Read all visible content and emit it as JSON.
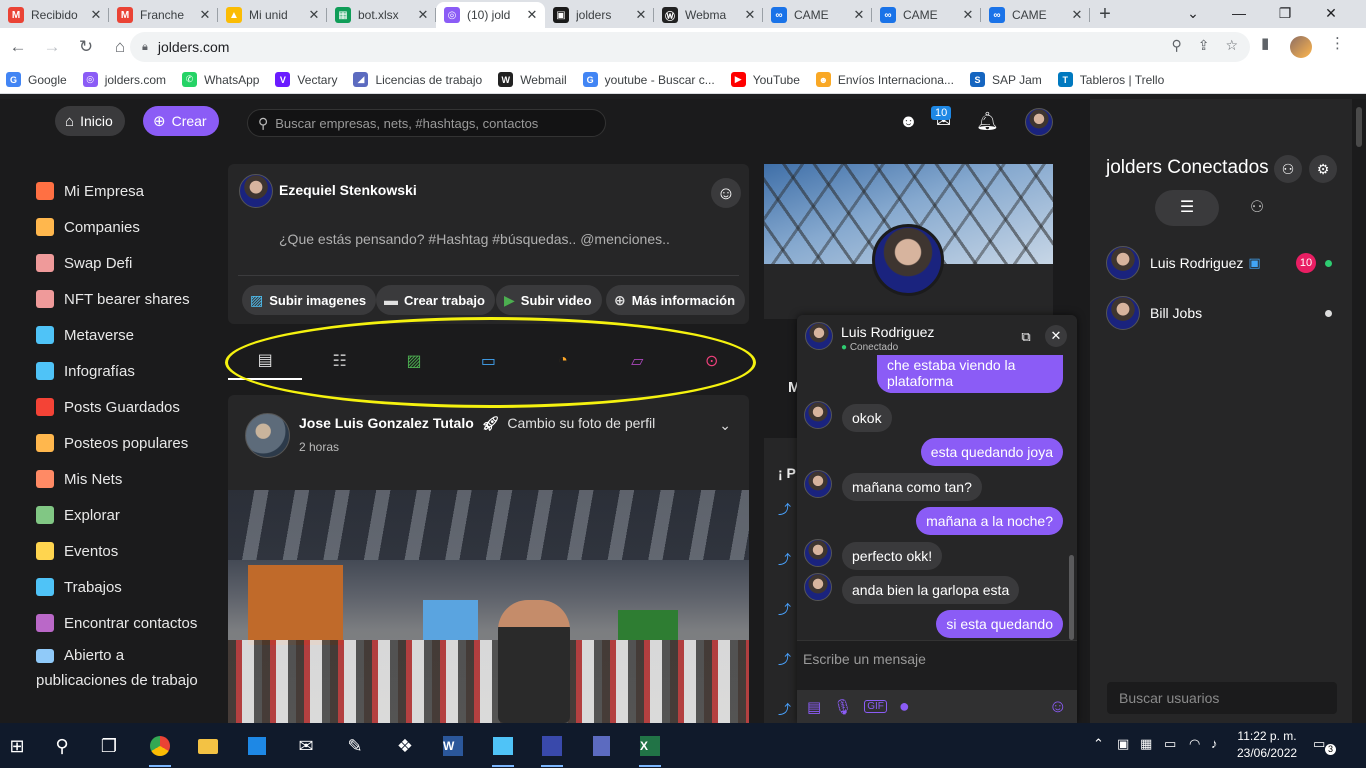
{
  "browser": {
    "tabs": [
      {
        "title": "Recibido",
        "icon": "gmail-icon",
        "color": "#ea4335",
        "glyph": "M"
      },
      {
        "title": "Franche",
        "icon": "gmail-icon",
        "color": "#ea4335",
        "glyph": "M"
      },
      {
        "title": "Mi unid",
        "icon": "drive-icon",
        "color": "#fbbc04",
        "glyph": "▲"
      },
      {
        "title": "bot.xlsx",
        "icon": "sheets-icon",
        "color": "#0f9d58",
        "glyph": "▦"
      },
      {
        "title": "(10) jold",
        "icon": "jolders-icon",
        "color": "#8b5cf6",
        "glyph": "◎"
      },
      {
        "title": "jolders",
        "icon": "jolders-icon",
        "color": "#1a1a1a",
        "glyph": "▣"
      },
      {
        "title": "Webma",
        "icon": "webmail-icon",
        "color": "#222",
        "glyph": "Ⓦ"
      },
      {
        "title": "CAME",
        "icon": "link-icon",
        "color": "#1a73e8",
        "glyph": "∞"
      },
      {
        "title": "CAME",
        "icon": "link-icon",
        "color": "#1a73e8",
        "glyph": "∞"
      },
      {
        "title": "CAME",
        "icon": "link-icon",
        "color": "#1a73e8",
        "glyph": "∞"
      }
    ],
    "active_tab": 4,
    "url": "jolders.com",
    "bookmarks": [
      {
        "label": "Google",
        "icon": "google-icon",
        "color": "#4285f4",
        "glyph": "G"
      },
      {
        "label": "jolders.com",
        "icon": "jolders-icon",
        "color": "#8b5cf6",
        "glyph": "◎"
      },
      {
        "label": "WhatsApp",
        "icon": "whatsapp-icon",
        "color": "#25d366",
        "glyph": "✆"
      },
      {
        "label": "Vectary",
        "icon": "vectary-icon",
        "color": "#6a1bff",
        "glyph": "V"
      },
      {
        "label": "Licencias de trabajo",
        "icon": "licencias-icon",
        "color": "#5c6bc0",
        "glyph": "◢"
      },
      {
        "label": "Webmail",
        "icon": "webmail-icon",
        "color": "#222",
        "glyph": "W"
      },
      {
        "label": "youtube - Buscar c...",
        "icon": "google-icon",
        "color": "#4285f4",
        "glyph": "G"
      },
      {
        "label": "YouTube",
        "icon": "youtube-icon",
        "color": "#ff0000",
        "glyph": "▶"
      },
      {
        "label": "Envíos Internaciona...",
        "icon": "envios-icon",
        "color": "#f9a825",
        "glyph": "☻"
      },
      {
        "label": "SAP Jam",
        "icon": "sap-icon",
        "color": "#1565c0",
        "glyph": "S"
      },
      {
        "label": "Tableros | Trello",
        "icon": "trello-icon",
        "color": "#0079bf",
        "glyph": "T"
      }
    ]
  },
  "appnav": {
    "home_label": "Inicio",
    "create_label": "Crear",
    "search_placeholder": "Buscar empresas, nets, #hashtags, contactos",
    "messages_badge": "10"
  },
  "sidebar": {
    "items": [
      {
        "label": "Mi Empresa",
        "icon": "company-icon",
        "color": "#ff7043"
      },
      {
        "label": "Companies",
        "icon": "companies-icon",
        "color": "#ffb74d"
      },
      {
        "label": "Swap Defi",
        "icon": "swap-icon",
        "color": "#ef9a9a"
      },
      {
        "label": "NFT bearer shares",
        "icon": "nft-icon",
        "color": "#ef9a9a"
      },
      {
        "label": "Metaverse",
        "icon": "metaverse-icon",
        "color": "#4fc3f7"
      },
      {
        "label": "Infografías",
        "icon": "infographic-icon",
        "color": "#4fc3f7"
      },
      {
        "label": "Posts Guardados",
        "icon": "bookmark-icon",
        "color": "#f44336"
      },
      {
        "label": "Posteos populares",
        "icon": "popular-icon",
        "color": "#ffb74d"
      },
      {
        "label": "Mis Nets",
        "icon": "nets-icon",
        "color": "#ff8a65"
      },
      {
        "label": "Explorar",
        "icon": "explore-icon",
        "color": "#81c784"
      },
      {
        "label": "Eventos",
        "icon": "calendar-icon",
        "color": "#ffd54f"
      },
      {
        "label": "Trabajos",
        "icon": "briefcase-icon",
        "color": "#4fc3f7"
      },
      {
        "label": "Encontrar contactos",
        "icon": "find-contacts-icon",
        "color": "#ba68c8"
      }
    ],
    "last_item": {
      "label_line1": "Abierto a",
      "label_line2": "publicaciones de trabajo",
      "icon": "open-work-icon",
      "color": "#90caf9"
    }
  },
  "composer": {
    "author": "Ezequiel Stenkowski",
    "placeholder": "¿Que estás pensando? #Hashtag #búsquedas.. @menciones..",
    "actions": [
      {
        "label": "Subir imagenes",
        "icon": "image-icon",
        "color": "#4fc3f7"
      },
      {
        "label": "Crear trabajo",
        "icon": "briefcase-icon",
        "color": "#e0e0e0"
      },
      {
        "label": "Subir video",
        "icon": "video-icon",
        "color": "#4caf50"
      },
      {
        "label": "Más información",
        "icon": "plus-circle-icon",
        "color": "#e0e0e0"
      }
    ]
  },
  "filter_tabs": [
    {
      "name": "all-posts",
      "icon": "document-icon",
      "glyph": "▤",
      "color": "#e0e0e0"
    },
    {
      "name": "list",
      "icon": "list-icon",
      "glyph": "☷",
      "color": "#bdbdbd"
    },
    {
      "name": "images",
      "icon": "image-icon",
      "glyph": "▨",
      "color": "#4caf50"
    },
    {
      "name": "videos",
      "icon": "video-icon",
      "glyph": "▭",
      "color": "#42a5f5"
    },
    {
      "name": "music",
      "icon": "music-icon",
      "glyph": "◔",
      "color": "#ffa726"
    },
    {
      "name": "files",
      "icon": "file-icon",
      "glyph": "▱",
      "color": "#ab47bc"
    },
    {
      "name": "places",
      "icon": "location-icon",
      "glyph": "⊙",
      "color": "#ec407a"
    }
  ],
  "post": {
    "author": "Jose Luis Gonzalez Tutalo",
    "action": "Cambio su foto de perfil",
    "time": "2 horas"
  },
  "side_card": {
    "partial_letter_1": "M",
    "partial_letter_2": "¡ P"
  },
  "chat": {
    "name": "Luis Rodriguez",
    "status": "Conectado",
    "messages": [
      {
        "dir": "out",
        "text_line1": "che estaba viendo la",
        "text_line2": "plataforma"
      },
      {
        "dir": "in",
        "text": "okok"
      },
      {
        "dir": "out",
        "text": "esta quedando joya"
      },
      {
        "dir": "in",
        "text": "mañana como tan?"
      },
      {
        "dir": "out",
        "text": "mañana a la noche?"
      },
      {
        "dir": "in",
        "text": "perfecto okk!"
      },
      {
        "dir": "in",
        "text": "anda bien la garlopa esta"
      },
      {
        "dir": "out",
        "text": "si esta quedando"
      }
    ],
    "input_placeholder": "Escribe un mensaje"
  },
  "connected": {
    "title": "jolders Conectados",
    "users": [
      {
        "name": "Luis Rodriguez",
        "badge": "10",
        "online_color": "#2ecc71"
      },
      {
        "name": "Bill Jobs",
        "badge": "",
        "online_color": "#dddddd"
      }
    ],
    "search_placeholder": "Buscar usuarios"
  },
  "taskbar": {
    "time": "11:22 p. m.",
    "date": "23/06/2022",
    "notifications": "3"
  }
}
